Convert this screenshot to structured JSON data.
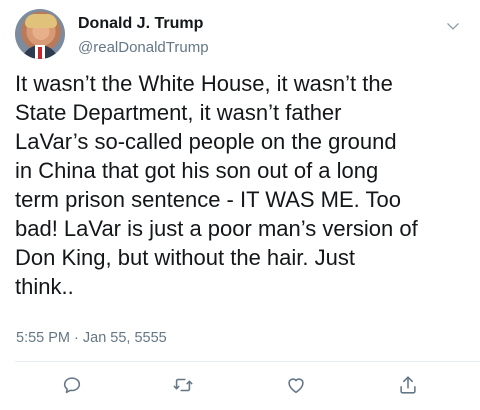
{
  "author": {
    "name": "Donald J. Trump",
    "handle": "@realDonaldTrump"
  },
  "tweet": {
    "text": "It wasn’t the White House, it wasn’t the\nState Department, it wasn’t father\nLaVar’s so-called people on the ground\nin China that got his son out of a long\nterm prison sentence - IT WAS ME. Too\nbad! LaVar is just a poor man’s version of\nDon King, but without the hair. Just\nthink..",
    "timestamp": "5:55 PM · Jan 55, 5555"
  },
  "icons": {
    "menu": "chevron-down-icon",
    "reply": "reply-icon",
    "retweet": "retweet-icon",
    "like": "heart-icon",
    "share": "share-icon"
  },
  "colors": {
    "text": "#14171a",
    "secondary": "#657786",
    "divider": "#e6ecf0",
    "icon": "#657786"
  }
}
